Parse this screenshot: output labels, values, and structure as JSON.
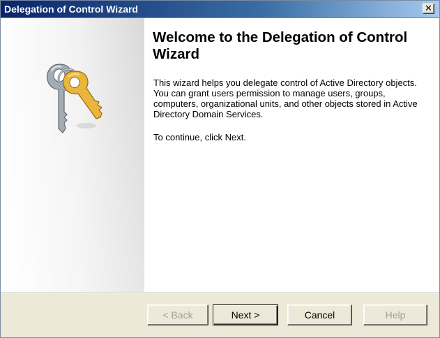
{
  "window": {
    "title": "Delegation of Control Wizard",
    "close_label": "×"
  },
  "welcome": {
    "heading": "Welcome to the Delegation of Control Wizard",
    "description": "This wizard helps you delegate control of Active Directory objects. You can grant users permission to manage users, groups, computers, organizational units, and other objects stored in Active Directory Domain Services.",
    "instruction": "To continue, click Next."
  },
  "buttons": {
    "back": "< Back",
    "next": "Next >",
    "cancel": "Cancel",
    "help": "Help"
  },
  "icons": {
    "wizard_graphic": "keys-icon",
    "close": "close-icon"
  },
  "colors": {
    "titlebar_start": "#0a246a",
    "titlebar_end": "#a6caf0",
    "dialog_face": "#ece9d8",
    "key_gold": "#e8b23a",
    "key_silver": "#9aa3ab"
  }
}
